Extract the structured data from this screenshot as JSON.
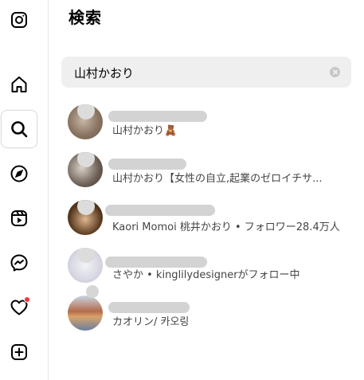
{
  "sidebar": {
    "icons": [
      "instagram-logo-icon",
      "home-icon",
      "search-icon",
      "explore-compass-icon",
      "reels-icon",
      "messenger-icon",
      "heart-icon",
      "create-plus-icon"
    ],
    "notification_dot_color": "#ff3040"
  },
  "search_panel": {
    "title": "検索",
    "query": "山村かおり"
  },
  "results": [
    {
      "subtitle": "山村かおり🧸"
    },
    {
      "subtitle": "山村かおり【女性の自立,起業のゼロイチサ..."
    },
    {
      "subtitle": "Kaori Momoi 桃井かおり • フォロワー28.4万人"
    },
    {
      "subtitle": "さやか • kinglilydesignerがフォロー中"
    },
    {
      "subtitle": "カオリン/ 카오링"
    }
  ]
}
